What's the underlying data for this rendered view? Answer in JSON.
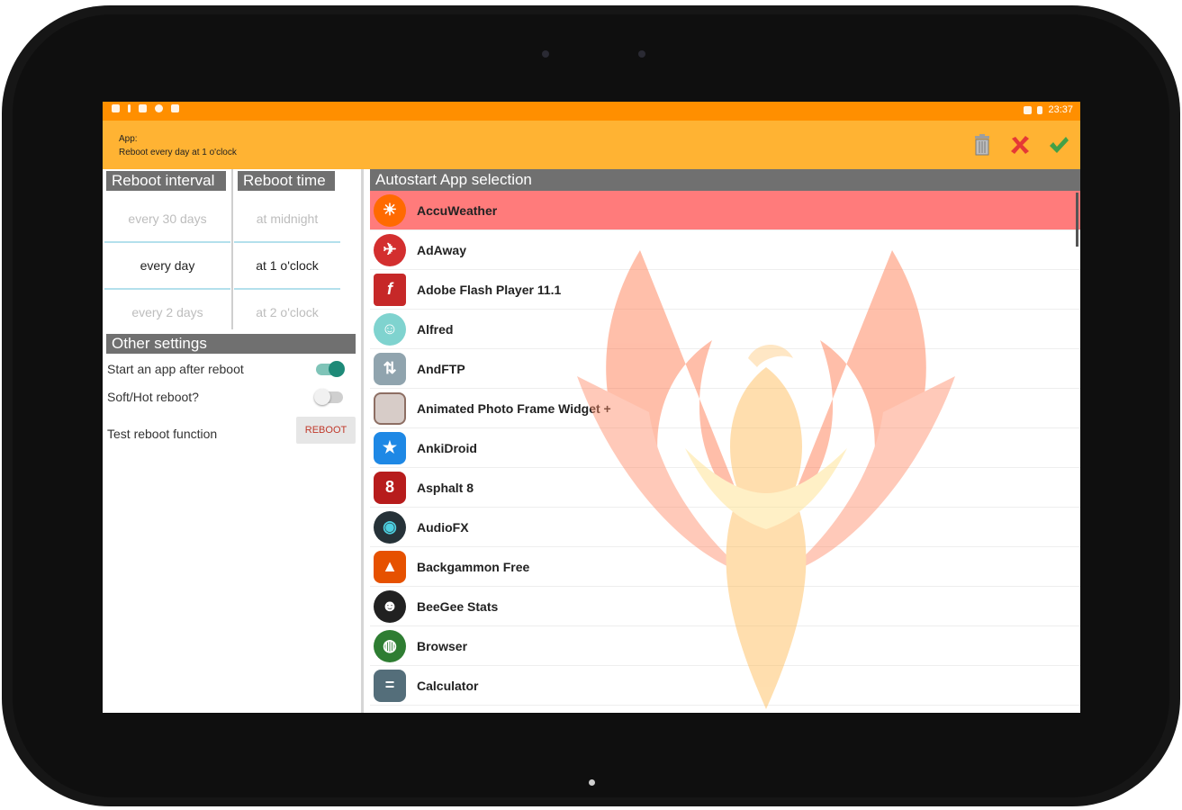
{
  "statusbar": {
    "time": "23:37"
  },
  "actionbar": {
    "title_line1": "App:",
    "title_line2": "Reboot every day at 1 o'clock",
    "icons": [
      "trash-icon",
      "cancel-icon",
      "confirm-icon"
    ]
  },
  "left": {
    "interval_header": "Reboot interval",
    "time_header": "Reboot time",
    "intervals": [
      "every 30 days",
      "every day",
      "every 2 days"
    ],
    "times": [
      "at midnight",
      "at 1 o'clock",
      "at 2 o'clock"
    ],
    "other_header": "Other settings",
    "settings": {
      "start_app_label": "Start an app after reboot",
      "start_app_on": true,
      "soft_hot_label": "Soft/Hot reboot?",
      "soft_hot_on": false,
      "test_label": "Test reboot function",
      "reboot_button": "REBOOT"
    }
  },
  "right": {
    "header": "Autostart App selection",
    "apps": [
      "AccuWeather",
      "AdAway",
      "Adobe Flash Player 11.1",
      "Alfred",
      "AndFTP",
      "Animated Photo Frame Widget +",
      "AnkiDroid",
      "Asphalt 8",
      "AudioFX",
      "Backgammon Free",
      "BeeGee Stats",
      "Browser",
      "Calculator"
    ],
    "selected_index": 0
  },
  "colors": {
    "statusbar": "#ff8f00",
    "actionbar": "#ffb333",
    "selected_row": "#ff7b7b",
    "header_gray": "#707070",
    "toggle_on": "#1e8a78"
  }
}
